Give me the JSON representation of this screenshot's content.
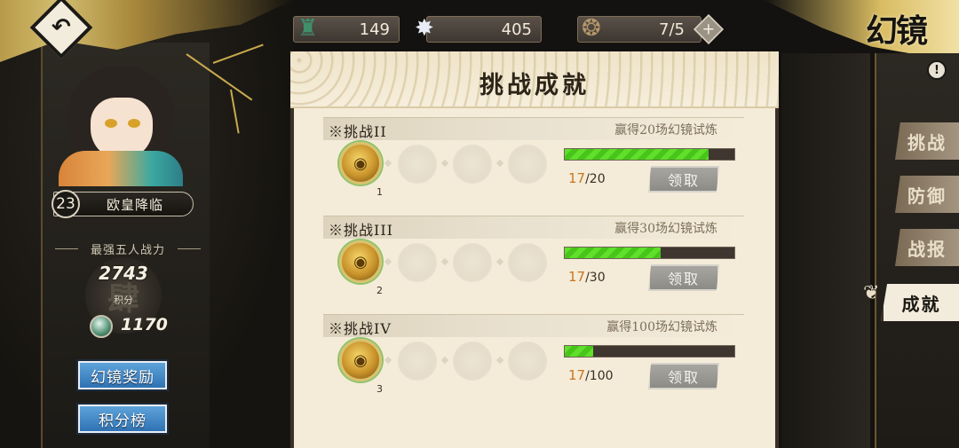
{
  "top_bar": {
    "resources": [
      {
        "name": "jade-token",
        "value": "149",
        "icon": "jade-icon"
      },
      {
        "name": "star-crystal",
        "value": "405",
        "icon": "star-icon"
      },
      {
        "name": "stamina",
        "value": "7/5",
        "icon": "gourd-icon"
      }
    ]
  },
  "corner_title": "幻镜",
  "player": {
    "level": "23",
    "name": "欧皇降临",
    "power_label": "最强五人战力",
    "power_value": "2743",
    "emblem_char": "肆",
    "score_label": "积分",
    "score_value": "1170"
  },
  "left_buttons": {
    "reward_label": "幻镜奖励",
    "ranking_label": "积分榜"
  },
  "panel": {
    "title": "挑战成就",
    "claim_label": "领取",
    "achievements": [
      {
        "title": "※挑战II",
        "desc": "赢得20场幻镜试炼",
        "current": "17",
        "total": "/20",
        "progress": 0.85,
        "reward_count": "1"
      },
      {
        "title": "※挑战III",
        "desc": "赢得30场幻镜试炼",
        "current": "17",
        "total": "/30",
        "progress": 0.567,
        "reward_count": "2"
      },
      {
        "title": "※挑战IV",
        "desc": "赢得100场幻镜试炼",
        "current": "17",
        "total": "/100",
        "progress": 0.17,
        "reward_count": "3"
      }
    ]
  },
  "right_tabs": [
    {
      "label": "挑战"
    },
    {
      "label": "防御"
    },
    {
      "label": "战报"
    },
    {
      "label": "成就"
    }
  ],
  "colors": {
    "progress": "#5fe02a",
    "current_count": "#c9751f",
    "panel_bg": "#f4ecd9",
    "blue_button": "#3f86c6",
    "gold": "#c9a94e"
  }
}
